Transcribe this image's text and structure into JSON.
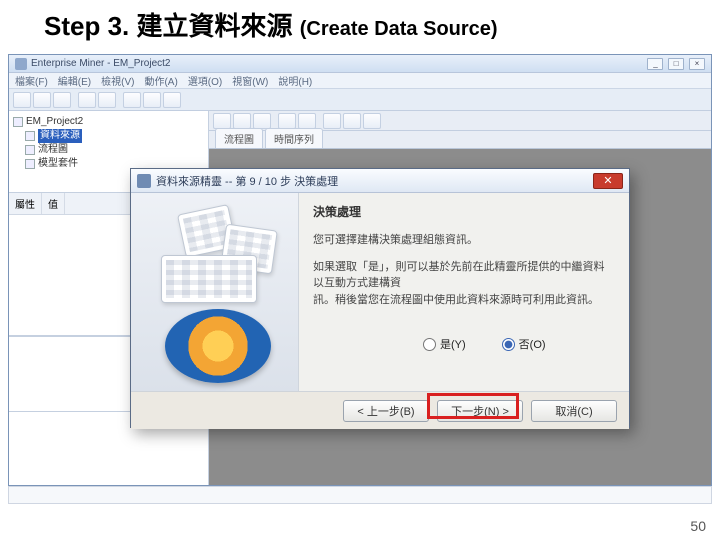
{
  "slide": {
    "step": "Step 3.",
    "title_cjk": "建立資料來源",
    "title_paren": "(Create Data Source)",
    "page_number": "50"
  },
  "app": {
    "title": "Enterprise Miner - EM_Project2",
    "menu": [
      "檔案(F)",
      "編輯(E)",
      "檢視(V)",
      "動作(A)",
      "選項(O)",
      "視窗(W)",
      "說明(H)"
    ],
    "win_buttons": {
      "min": "_",
      "max": "□",
      "close": "×"
    },
    "tree": {
      "root": "EM_Project2",
      "items": [
        "資料來源",
        "流程圖",
        "模型套件"
      ],
      "selected": "資料來源"
    },
    "prop_headers": {
      "name": "屬性",
      "value": "值"
    },
    "tabs": [
      "流程圖",
      "時間序列"
    ]
  },
  "wizard": {
    "title": "資料來源精靈 -- 第 9 / 10 步 決策處理",
    "close_glyph": "✕",
    "heading": "決策處理",
    "line1": "您可選擇建構決策處理組態資訊。",
    "line2": "如果選取「是」，則可以基於先前在此精靈所提供的中繼資料以互動方式建構資",
    "line3": "訊。稍後當您在流程圖中使用此資料來源時可利用此資訊。",
    "radio_yes": "是(Y)",
    "radio_no": "否(O)",
    "btn_back": "< 上一步(B)",
    "btn_next": "下一步(N) >",
    "btn_cancel": "取消(C)"
  }
}
